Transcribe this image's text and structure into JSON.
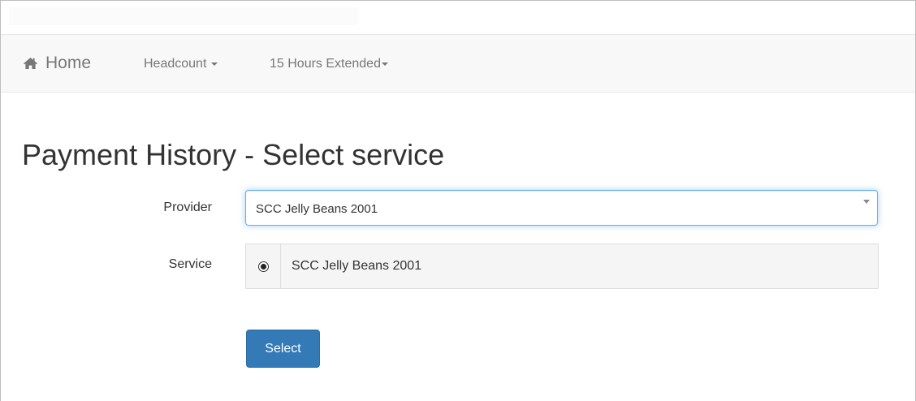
{
  "navbar": {
    "home_label": "Home",
    "items": [
      {
        "label": "Headcount"
      },
      {
        "label": "15 Hours Extended"
      }
    ]
  },
  "page": {
    "title": "Payment History - Select service"
  },
  "form": {
    "provider_label": "Provider",
    "provider_value": "SCC Jelly Beans 2001",
    "service_label": "Service",
    "service_option": "SCC Jelly Beans 2001",
    "service_selected": true,
    "submit_label": "Select"
  },
  "colors": {
    "primary_button": "#337ab7",
    "navbar_bg": "#f8f8f8",
    "focus_border": "#66afe9"
  },
  "icons": {
    "home": "home-icon",
    "dropdown": "caret-down-icon"
  }
}
